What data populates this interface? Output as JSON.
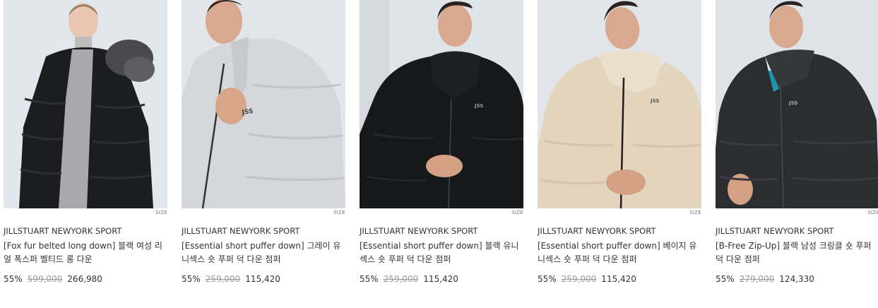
{
  "size_label": "SIZE",
  "products": [
    {
      "brand": "JILLSTUART NEWYORK SPORT",
      "name": "[Fox fur belted long down] 블랙 여성 리얼 폭스퍼 벨티드 롱 다운",
      "discount": "55%",
      "original_price": "599,000",
      "price": "266,980",
      "jacket_color": "#1c1d1f",
      "background_color": "#dde3e8"
    },
    {
      "brand": "JILLSTUART NEWYORK SPORT",
      "name": "[Essential short puffer down] 그레이 유니섹스 숏 푸퍼 덕 다운 점퍼",
      "discount": "55%",
      "original_price": "259,000",
      "price": "115,420",
      "jacket_color": "#d6d7db",
      "background_color": "#e2e6ea"
    },
    {
      "brand": "JILLSTUART NEWYORK SPORT",
      "name": "[Essential short puffer down] 블랙 유니섹스 숏 푸퍼 덕 다운 점퍼",
      "discount": "55%",
      "original_price": "259,000",
      "price": "115,420",
      "jacket_color": "#17181a",
      "background_color": "#dfe4e9"
    },
    {
      "brand": "JILLSTUART NEWYORK SPORT",
      "name": "[Essential short puffer down] 베이지 유니섹스 숏 푸퍼 덕 다운 점퍼",
      "discount": "55%",
      "original_price": "259,000",
      "price": "115,420",
      "jacket_color": "#e3d5bd",
      "background_color": "#e1e5ea"
    },
    {
      "brand": "JILLSTUART NEWYORK SPORT",
      "name": "[B-Free Zip-Up] 블랙 남성 크링클 숏 푸퍼 덕 다운 점퍼",
      "discount": "55%",
      "original_price": "279,000",
      "price": "124,330",
      "jacket_color": "#2c2d31",
      "background_color": "#dfe3e8"
    }
  ]
}
